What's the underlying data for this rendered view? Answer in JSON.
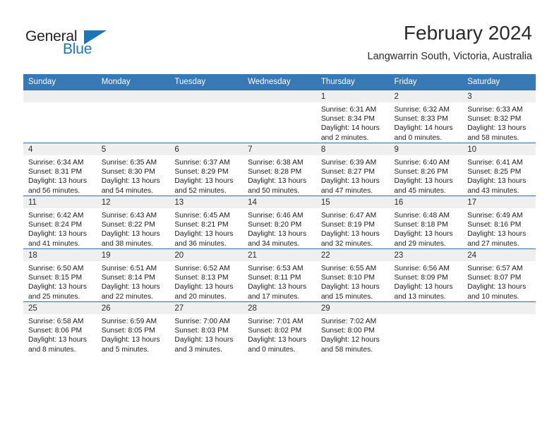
{
  "brand": {
    "name_dark": "General",
    "name_light": "Blue",
    "flag_icon": "blue-flag-triangle",
    "accent_color": "#1b75bb"
  },
  "header": {
    "title": "February 2024",
    "subtitle": "Langwarrin South, Victoria, Australia"
  },
  "theme": {
    "header_row_bg": "#3878b4",
    "daynum_band_bg": "#efefef",
    "row_divider": "#2f6fae"
  },
  "weekday_headers": [
    "Sunday",
    "Monday",
    "Tuesday",
    "Wednesday",
    "Thursday",
    "Friday",
    "Saturday"
  ],
  "labels": {
    "sunrise_prefix": "Sunrise:",
    "sunset_prefix": "Sunset:",
    "daylight_prefix": "Daylight:"
  },
  "weeks": [
    [
      {
        "day": "",
        "empty": true,
        "sunrise": "",
        "sunset": "",
        "daylight_line1": "",
        "daylight_line2": ""
      },
      {
        "day": "",
        "empty": true,
        "sunrise": "",
        "sunset": "",
        "daylight_line1": "",
        "daylight_line2": ""
      },
      {
        "day": "",
        "empty": true,
        "sunrise": "",
        "sunset": "",
        "daylight_line1": "",
        "daylight_line2": ""
      },
      {
        "day": "",
        "empty": true,
        "sunrise": "",
        "sunset": "",
        "daylight_line1": "",
        "daylight_line2": ""
      },
      {
        "day": "1",
        "empty": false,
        "sunrise": "Sunrise: 6:31 AM",
        "sunset": "Sunset: 8:34 PM",
        "daylight_line1": "Daylight: 14 hours",
        "daylight_line2": "and 2 minutes."
      },
      {
        "day": "2",
        "empty": false,
        "sunrise": "Sunrise: 6:32 AM",
        "sunset": "Sunset: 8:33 PM",
        "daylight_line1": "Daylight: 14 hours",
        "daylight_line2": "and 0 minutes."
      },
      {
        "day": "3",
        "empty": false,
        "sunrise": "Sunrise: 6:33 AM",
        "sunset": "Sunset: 8:32 PM",
        "daylight_line1": "Daylight: 13 hours",
        "daylight_line2": "and 58 minutes."
      }
    ],
    [
      {
        "day": "4",
        "empty": false,
        "sunrise": "Sunrise: 6:34 AM",
        "sunset": "Sunset: 8:31 PM",
        "daylight_line1": "Daylight: 13 hours",
        "daylight_line2": "and 56 minutes."
      },
      {
        "day": "5",
        "empty": false,
        "sunrise": "Sunrise: 6:35 AM",
        "sunset": "Sunset: 8:30 PM",
        "daylight_line1": "Daylight: 13 hours",
        "daylight_line2": "and 54 minutes."
      },
      {
        "day": "6",
        "empty": false,
        "sunrise": "Sunrise: 6:37 AM",
        "sunset": "Sunset: 8:29 PM",
        "daylight_line1": "Daylight: 13 hours",
        "daylight_line2": "and 52 minutes."
      },
      {
        "day": "7",
        "empty": false,
        "sunrise": "Sunrise: 6:38 AM",
        "sunset": "Sunset: 8:28 PM",
        "daylight_line1": "Daylight: 13 hours",
        "daylight_line2": "and 50 minutes."
      },
      {
        "day": "8",
        "empty": false,
        "sunrise": "Sunrise: 6:39 AM",
        "sunset": "Sunset: 8:27 PM",
        "daylight_line1": "Daylight: 13 hours",
        "daylight_line2": "and 47 minutes."
      },
      {
        "day": "9",
        "empty": false,
        "sunrise": "Sunrise: 6:40 AM",
        "sunset": "Sunset: 8:26 PM",
        "daylight_line1": "Daylight: 13 hours",
        "daylight_line2": "and 45 minutes."
      },
      {
        "day": "10",
        "empty": false,
        "sunrise": "Sunrise: 6:41 AM",
        "sunset": "Sunset: 8:25 PM",
        "daylight_line1": "Daylight: 13 hours",
        "daylight_line2": "and 43 minutes."
      }
    ],
    [
      {
        "day": "11",
        "empty": false,
        "sunrise": "Sunrise: 6:42 AM",
        "sunset": "Sunset: 8:24 PM",
        "daylight_line1": "Daylight: 13 hours",
        "daylight_line2": "and 41 minutes."
      },
      {
        "day": "12",
        "empty": false,
        "sunrise": "Sunrise: 6:43 AM",
        "sunset": "Sunset: 8:22 PM",
        "daylight_line1": "Daylight: 13 hours",
        "daylight_line2": "and 38 minutes."
      },
      {
        "day": "13",
        "empty": false,
        "sunrise": "Sunrise: 6:45 AM",
        "sunset": "Sunset: 8:21 PM",
        "daylight_line1": "Daylight: 13 hours",
        "daylight_line2": "and 36 minutes."
      },
      {
        "day": "14",
        "empty": false,
        "sunrise": "Sunrise: 6:46 AM",
        "sunset": "Sunset: 8:20 PM",
        "daylight_line1": "Daylight: 13 hours",
        "daylight_line2": "and 34 minutes."
      },
      {
        "day": "15",
        "empty": false,
        "sunrise": "Sunrise: 6:47 AM",
        "sunset": "Sunset: 8:19 PM",
        "daylight_line1": "Daylight: 13 hours",
        "daylight_line2": "and 32 minutes."
      },
      {
        "day": "16",
        "empty": false,
        "sunrise": "Sunrise: 6:48 AM",
        "sunset": "Sunset: 8:18 PM",
        "daylight_line1": "Daylight: 13 hours",
        "daylight_line2": "and 29 minutes."
      },
      {
        "day": "17",
        "empty": false,
        "sunrise": "Sunrise: 6:49 AM",
        "sunset": "Sunset: 8:16 PM",
        "daylight_line1": "Daylight: 13 hours",
        "daylight_line2": "and 27 minutes."
      }
    ],
    [
      {
        "day": "18",
        "empty": false,
        "sunrise": "Sunrise: 6:50 AM",
        "sunset": "Sunset: 8:15 PM",
        "daylight_line1": "Daylight: 13 hours",
        "daylight_line2": "and 25 minutes."
      },
      {
        "day": "19",
        "empty": false,
        "sunrise": "Sunrise: 6:51 AM",
        "sunset": "Sunset: 8:14 PM",
        "daylight_line1": "Daylight: 13 hours",
        "daylight_line2": "and 22 minutes."
      },
      {
        "day": "20",
        "empty": false,
        "sunrise": "Sunrise: 6:52 AM",
        "sunset": "Sunset: 8:13 PM",
        "daylight_line1": "Daylight: 13 hours",
        "daylight_line2": "and 20 minutes."
      },
      {
        "day": "21",
        "empty": false,
        "sunrise": "Sunrise: 6:53 AM",
        "sunset": "Sunset: 8:11 PM",
        "daylight_line1": "Daylight: 13 hours",
        "daylight_line2": "and 17 minutes."
      },
      {
        "day": "22",
        "empty": false,
        "sunrise": "Sunrise: 6:55 AM",
        "sunset": "Sunset: 8:10 PM",
        "daylight_line1": "Daylight: 13 hours",
        "daylight_line2": "and 15 minutes."
      },
      {
        "day": "23",
        "empty": false,
        "sunrise": "Sunrise: 6:56 AM",
        "sunset": "Sunset: 8:09 PM",
        "daylight_line1": "Daylight: 13 hours",
        "daylight_line2": "and 13 minutes."
      },
      {
        "day": "24",
        "empty": false,
        "sunrise": "Sunrise: 6:57 AM",
        "sunset": "Sunset: 8:07 PM",
        "daylight_line1": "Daylight: 13 hours",
        "daylight_line2": "and 10 minutes."
      }
    ],
    [
      {
        "day": "25",
        "empty": false,
        "sunrise": "Sunrise: 6:58 AM",
        "sunset": "Sunset: 8:06 PM",
        "daylight_line1": "Daylight: 13 hours",
        "daylight_line2": "and 8 minutes."
      },
      {
        "day": "26",
        "empty": false,
        "sunrise": "Sunrise: 6:59 AM",
        "sunset": "Sunset: 8:05 PM",
        "daylight_line1": "Daylight: 13 hours",
        "daylight_line2": "and 5 minutes."
      },
      {
        "day": "27",
        "empty": false,
        "sunrise": "Sunrise: 7:00 AM",
        "sunset": "Sunset: 8:03 PM",
        "daylight_line1": "Daylight: 13 hours",
        "daylight_line2": "and 3 minutes."
      },
      {
        "day": "28",
        "empty": false,
        "sunrise": "Sunrise: 7:01 AM",
        "sunset": "Sunset: 8:02 PM",
        "daylight_line1": "Daylight: 13 hours",
        "daylight_line2": "and 0 minutes."
      },
      {
        "day": "29",
        "empty": false,
        "sunrise": "Sunrise: 7:02 AM",
        "sunset": "Sunset: 8:00 PM",
        "daylight_line1": "Daylight: 12 hours",
        "daylight_line2": "and 58 minutes."
      },
      {
        "day": "",
        "empty": true,
        "sunrise": "",
        "sunset": "",
        "daylight_line1": "",
        "daylight_line2": ""
      },
      {
        "day": "",
        "empty": true,
        "sunrise": "",
        "sunset": "",
        "daylight_line1": "",
        "daylight_line2": ""
      }
    ]
  ]
}
